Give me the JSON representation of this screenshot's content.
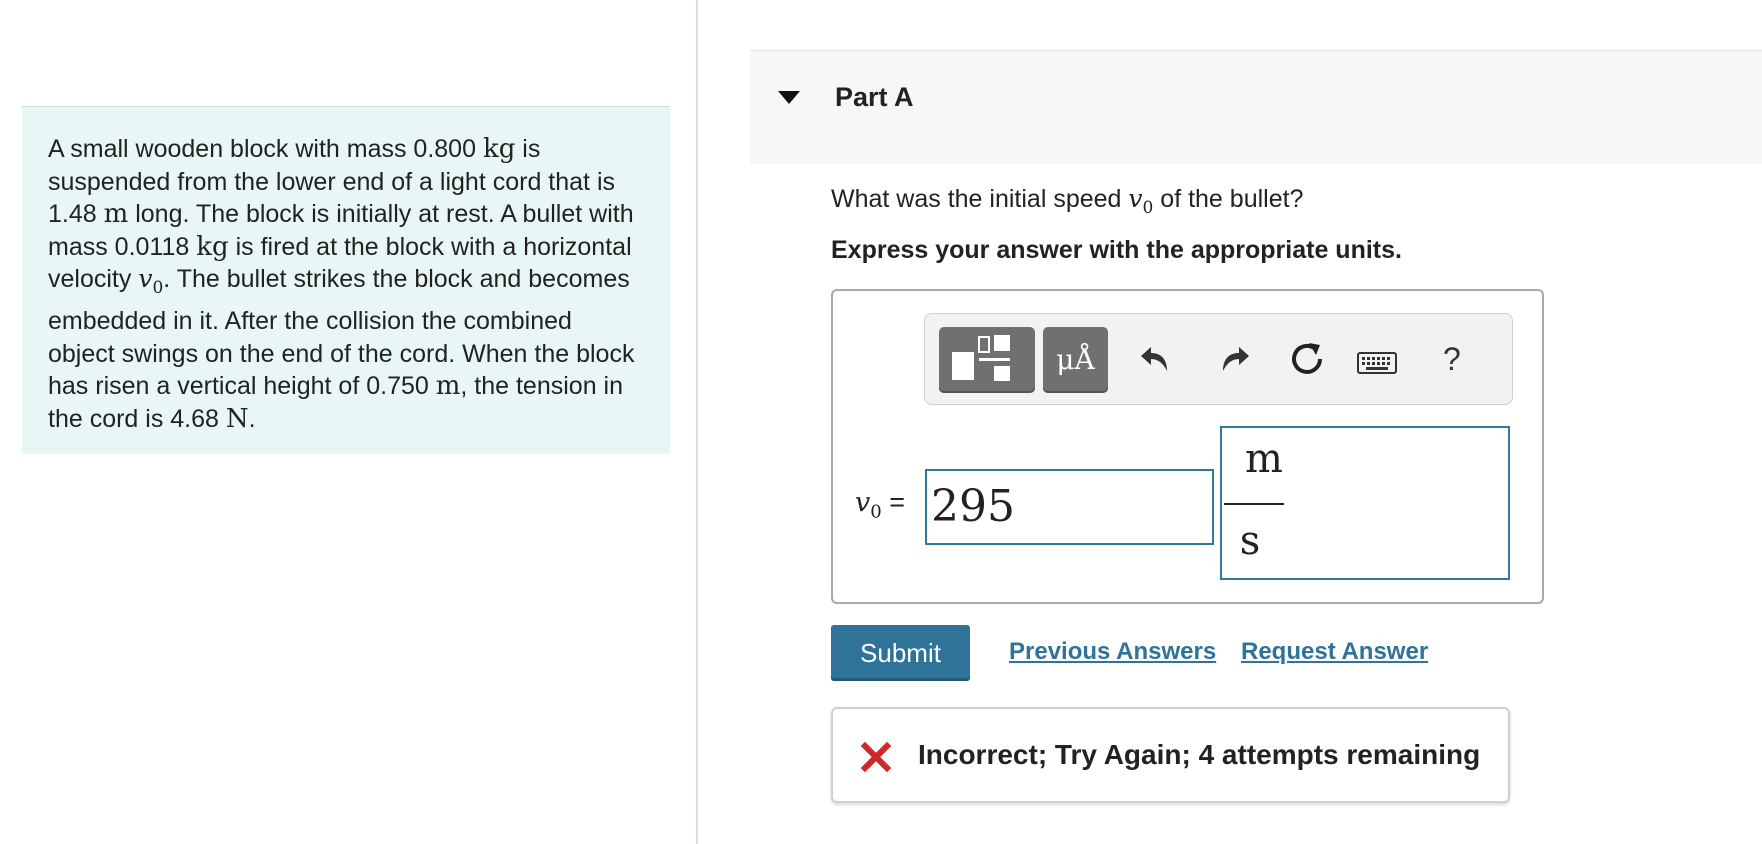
{
  "problem": {
    "segments": [
      {
        "t": "text",
        "v": "A small wooden block with mass 0.800 "
      },
      {
        "t": "unit",
        "v": "kg"
      },
      {
        "t": "text",
        "v": " is suspended from the lower end of a light cord that is 1.48 "
      },
      {
        "t": "unit",
        "v": "m"
      },
      {
        "t": "text",
        "v": " long. The block is initially at rest. A bullet with mass 0.0118 "
      },
      {
        "t": "unit",
        "v": "kg"
      },
      {
        "t": "text",
        "v": " is fired at the block with a horizontal velocity "
      },
      {
        "t": "math",
        "v": "v"
      },
      {
        "t": "sub",
        "v": "0"
      },
      {
        "t": "text",
        "v": ". The bullet strikes the block and becomes embedded in it. After the collision the combined object swings on the end of the cord. When the block has risen a vertical height of 0.750 "
      },
      {
        "t": "unit",
        "v": "m"
      },
      {
        "t": "text",
        "v": ", the tension in the cord is 4.68 "
      },
      {
        "t": "unit",
        "v": "N"
      },
      {
        "t": "text",
        "v": "."
      }
    ]
  },
  "part": {
    "title": "Part A"
  },
  "question": {
    "before": "What was the initial speed ",
    "var": "v",
    "sub": "0",
    "after": " of the bullet?"
  },
  "instruction": "Express your answer with the appropriate units.",
  "toolbar": {
    "mu_label": "μÅ",
    "help_label": "?",
    "icons": [
      "templates-icon",
      "units-icon",
      "undo-icon",
      "redo-icon",
      "reset-icon",
      "keyboard-icon",
      "help-icon"
    ]
  },
  "answer": {
    "var": "v",
    "sub": "0",
    "eq": " =",
    "value": "295",
    "unit_num": "m",
    "unit_den": "s"
  },
  "actions": {
    "submit": "Submit",
    "previous": "Previous Answers",
    "request": "Request Answer"
  },
  "feedback": {
    "text": "Incorrect; Try Again; 4 attempts remaining",
    "status": "incorrect",
    "color": "#d0272a"
  },
  "colors": {
    "accent": "#2f7399",
    "panel": "#e8f6f6",
    "error": "#d0272a"
  }
}
